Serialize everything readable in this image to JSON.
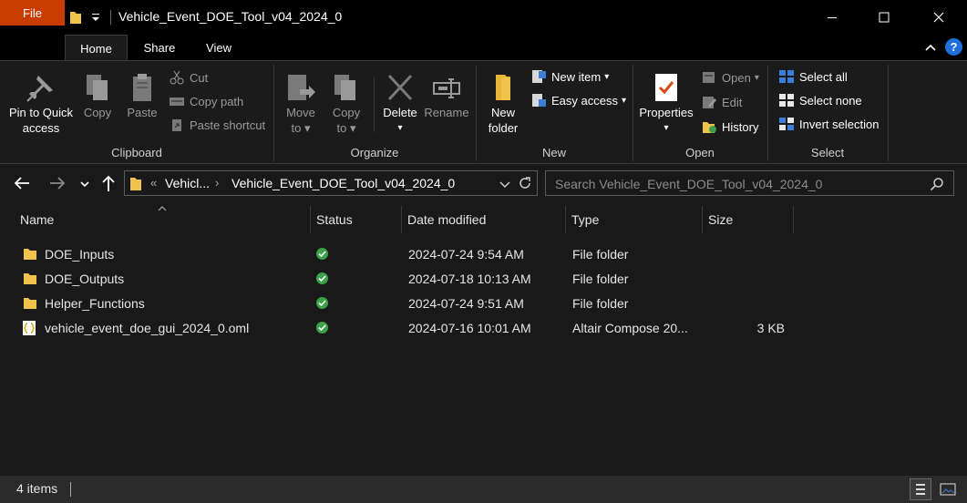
{
  "window": {
    "title": "Vehicle_Event_DOE_Tool_v04_2024_0"
  },
  "ribbon_tabs": {
    "file": "File",
    "home": "Home",
    "share": "Share",
    "view": "View"
  },
  "ribbon": {
    "clipboard": {
      "group_label": "Clipboard",
      "pin_line1": "Pin to Quick",
      "pin_line2": "access",
      "copy": "Copy",
      "paste": "Paste",
      "cut": "Cut",
      "copy_path": "Copy path",
      "paste_shortcut": "Paste shortcut"
    },
    "organize": {
      "group_label": "Organize",
      "move_to_line1": "Move",
      "move_to_line2": "to",
      "copy_to_line1": "Copy",
      "copy_to_line2": "to",
      "delete": "Delete",
      "rename": "Rename"
    },
    "new": {
      "group_label": "New",
      "new_folder_line1": "New",
      "new_folder_line2": "folder",
      "new_item": "New item",
      "easy_access": "Easy access"
    },
    "open": {
      "group_label": "Open",
      "properties": "Properties",
      "open": "Open",
      "edit": "Edit",
      "history": "History"
    },
    "select": {
      "group_label": "Select",
      "select_all": "Select all",
      "select_none": "Select none",
      "invert_selection": "Invert selection"
    }
  },
  "address": {
    "overflow": "«",
    "crumb_parent": "Vehicl...",
    "crumb_current": "Vehicle_Event_DOE_Tool_v04_2024_0",
    "search_placeholder": "Search Vehicle_Event_DOE_Tool_v04_2024_0"
  },
  "columns": {
    "name": "Name",
    "status": "Status",
    "date_modified": "Date modified",
    "type": "Type",
    "size": "Size"
  },
  "files": [
    {
      "name": "DOE_Inputs",
      "date": "2024-07-24 9:54 AM",
      "type": "File folder",
      "size": "",
      "kind": "folder"
    },
    {
      "name": "DOE_Outputs",
      "date": "2024-07-18 10:13 AM",
      "type": "File folder",
      "size": "",
      "kind": "folder"
    },
    {
      "name": "Helper_Functions",
      "date": "2024-07-24 9:51 AM",
      "type": "File folder",
      "size": "",
      "kind": "folder"
    },
    {
      "name": "vehicle_event_doe_gui_2024_0.oml",
      "date": "2024-07-16 10:01 AM",
      "type": "Altair Compose 20...",
      "size": "3 KB",
      "kind": "file"
    }
  ],
  "status_bar": {
    "item_count": "4 items"
  },
  "colors": {
    "background": "#191919",
    "title_bar": "#000000",
    "file_tab": "#c83c00",
    "status_ok": "#3ca24a",
    "folder": "#f0c44c",
    "help": "#1e6fd9"
  }
}
